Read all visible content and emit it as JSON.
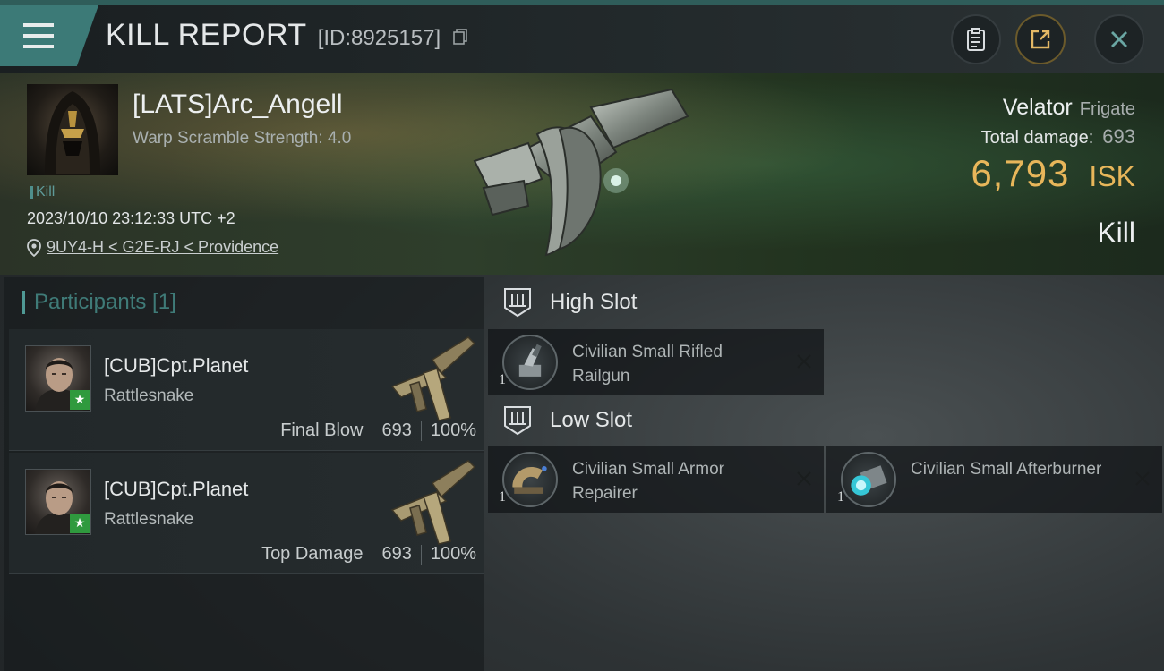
{
  "header": {
    "title": "KILL REPORT",
    "report_id": "[ID:8925157]"
  },
  "victim": {
    "pilot_name": "[LATS]Arc_Angell",
    "warp_scramble": "Warp Scramble Strength: 4.0",
    "tag": "Kill",
    "datetime": "2023/10/10 23:12:33 UTC +2",
    "location": "9UY4-H < G2E-RJ < Providence",
    "ship_name": "Velator",
    "ship_class": "Frigate",
    "total_damage_label": "Total damage:",
    "total_damage": "693",
    "isk_value": "6,793",
    "isk_unit": "ISK",
    "result": "Kill"
  },
  "participants": {
    "title": "Participants [1]",
    "items": [
      {
        "name": "[CUB]Cpt.Planet",
        "ship": "Rattlesnake",
        "role": "Final Blow",
        "damage": "693",
        "percent": "100%"
      },
      {
        "name": "[CUB]Cpt.Planet",
        "ship": "Rattlesnake",
        "role": "Top Damage",
        "damage": "693",
        "percent": "100%"
      }
    ]
  },
  "slots": {
    "high": {
      "label": "High Slot",
      "modules": [
        {
          "name": "Civilian Small Rifled Railgun",
          "qty": "1",
          "icon": "railgun-icon"
        }
      ]
    },
    "low": {
      "label": "Low Slot",
      "modules": [
        {
          "name": "Civilian Small Armor Repairer",
          "qty": "1",
          "icon": "armor-repairer-icon"
        },
        {
          "name": "Civilian Small Afterburner",
          "qty": "1",
          "icon": "afterburner-icon"
        }
      ]
    }
  },
  "colors": {
    "accent_teal": "#3c7a77",
    "isk_gold": "#e8b65a",
    "badge_green": "#2f9a3e"
  }
}
